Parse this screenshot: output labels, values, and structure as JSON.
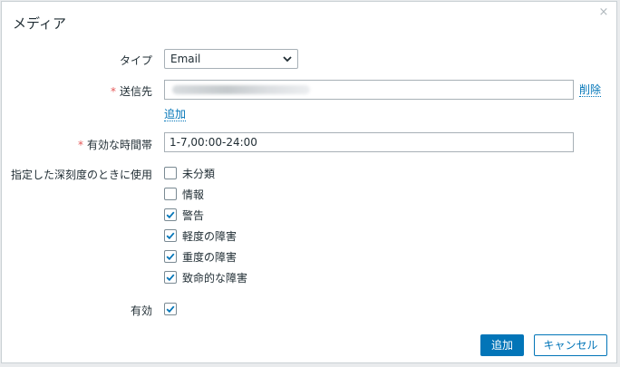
{
  "dialog": {
    "title": "メディア",
    "close_glyph": "×"
  },
  "form": {
    "type": {
      "label": "タイプ",
      "value": "Email"
    },
    "send_to": {
      "required_mark": "*",
      "label": "送信先",
      "remove_label": "削除",
      "add_label": "追加"
    },
    "when_active": {
      "required_mark": "*",
      "label": "有効な時間帯",
      "value": "1-7,00:00-24:00"
    },
    "severity": {
      "label": "指定した深刻度のときに使用",
      "items": [
        {
          "label": "未分類",
          "checked": false
        },
        {
          "label": "情報",
          "checked": false
        },
        {
          "label": "警告",
          "checked": true
        },
        {
          "label": "軽度の障害",
          "checked": true
        },
        {
          "label": "重度の障害",
          "checked": true
        },
        {
          "label": "致命的な障害",
          "checked": true
        }
      ]
    },
    "enabled": {
      "label": "有効",
      "checked": true
    }
  },
  "buttons": {
    "add": "追加",
    "cancel": "キャンセル"
  },
  "colors": {
    "accent": "#0275b8",
    "required": "#e45959"
  }
}
